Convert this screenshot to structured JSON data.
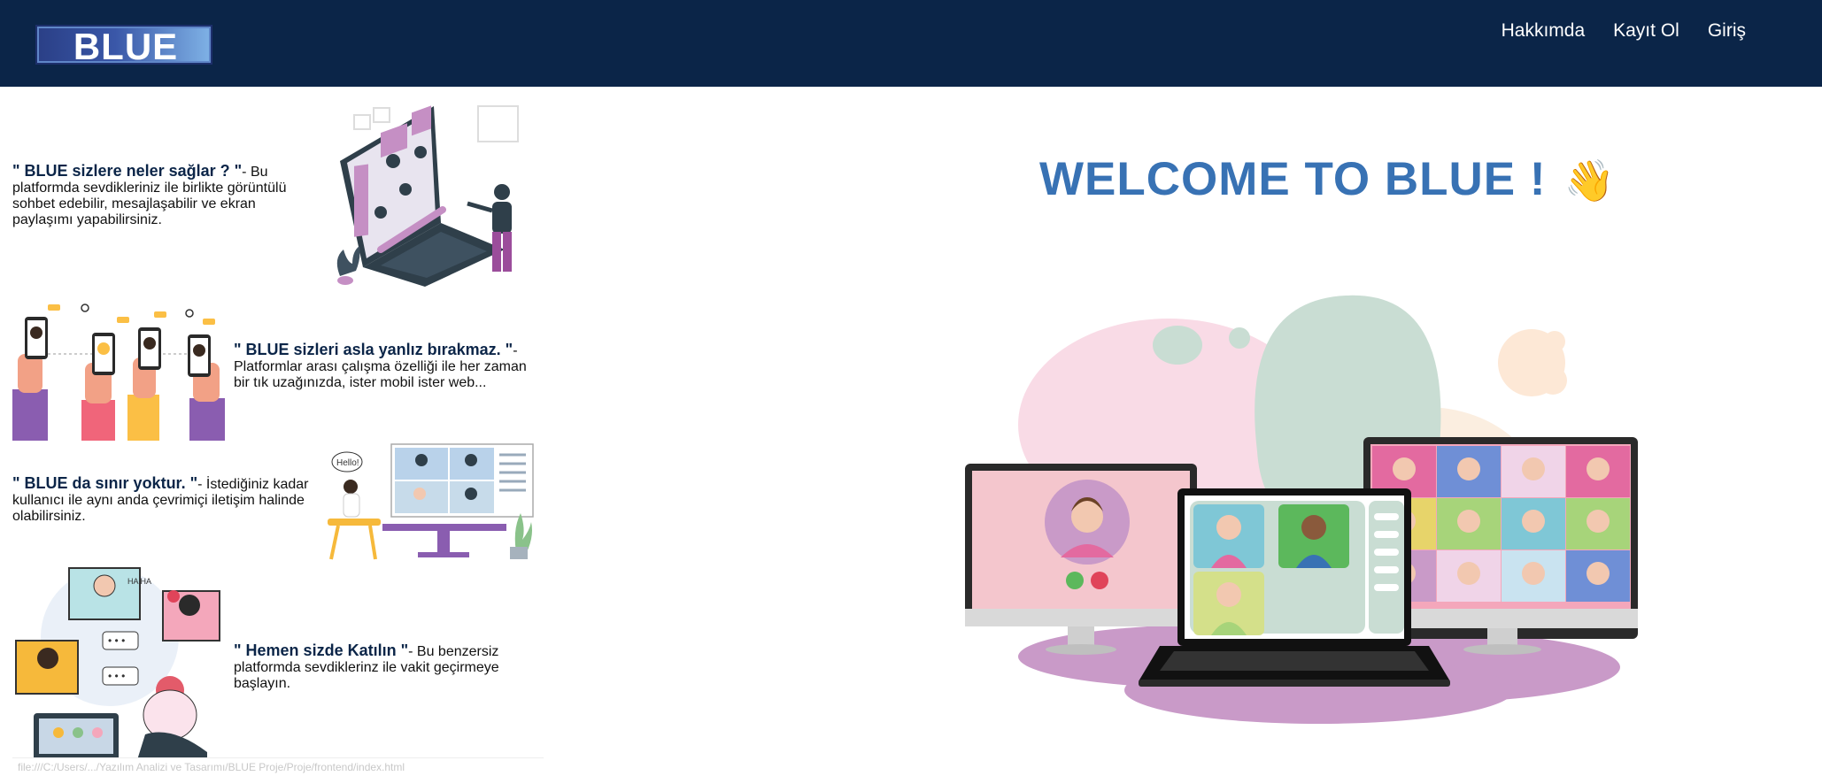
{
  "navbar": {
    "logo_text": "BLUE",
    "links": [
      {
        "label": "Hakkımda"
      },
      {
        "label": "Kayıt Ol"
      },
      {
        "label": "Giriş"
      }
    ]
  },
  "features": [
    {
      "title": "\" BLUE sizlere neler sağlar ? \"",
      "text": "- Bu platformda sevdikleriniz ile birlikte görüntülü sohbet edebilir, mesajlaşabilir ve ekran paylaşımı yapabilirsiniz."
    },
    {
      "title": "\" BLUE sizleri asla yanlız bırakmaz. \"",
      "text": "- Platformlar arası çalışma özelliği ile her zaman bir tık uzağınızda, ister mobil ister web..."
    },
    {
      "title": "\" BLUE da sınır yoktur. \"",
      "text": "- İstediğiniz kadar kullanıcı ile aynı anda çevrimiçi iletişim halinde olabilirsiniz."
    },
    {
      "title": "\" Hemen sizde Katılın \"",
      "text": "- Bu benzersiz platformda sevdiklerinz ile vakit geçirmeye başlayın."
    }
  ],
  "hero": {
    "title": "WELCOME TO BLUE !",
    "wave_icon": "👋"
  },
  "illustration_labels": {
    "hello_bubble": "Hello!",
    "hi_text": "HA HA"
  },
  "status_url": "file:///C:/Users/.../Yazılım Analizi ve Tasarımı/BLUE Proje/Proje/frontend/index.html",
  "colors": {
    "navbar": "#0b2548",
    "accent": "#3872b4",
    "purple": "#c58fc4",
    "pink": "#f4a7bb"
  }
}
